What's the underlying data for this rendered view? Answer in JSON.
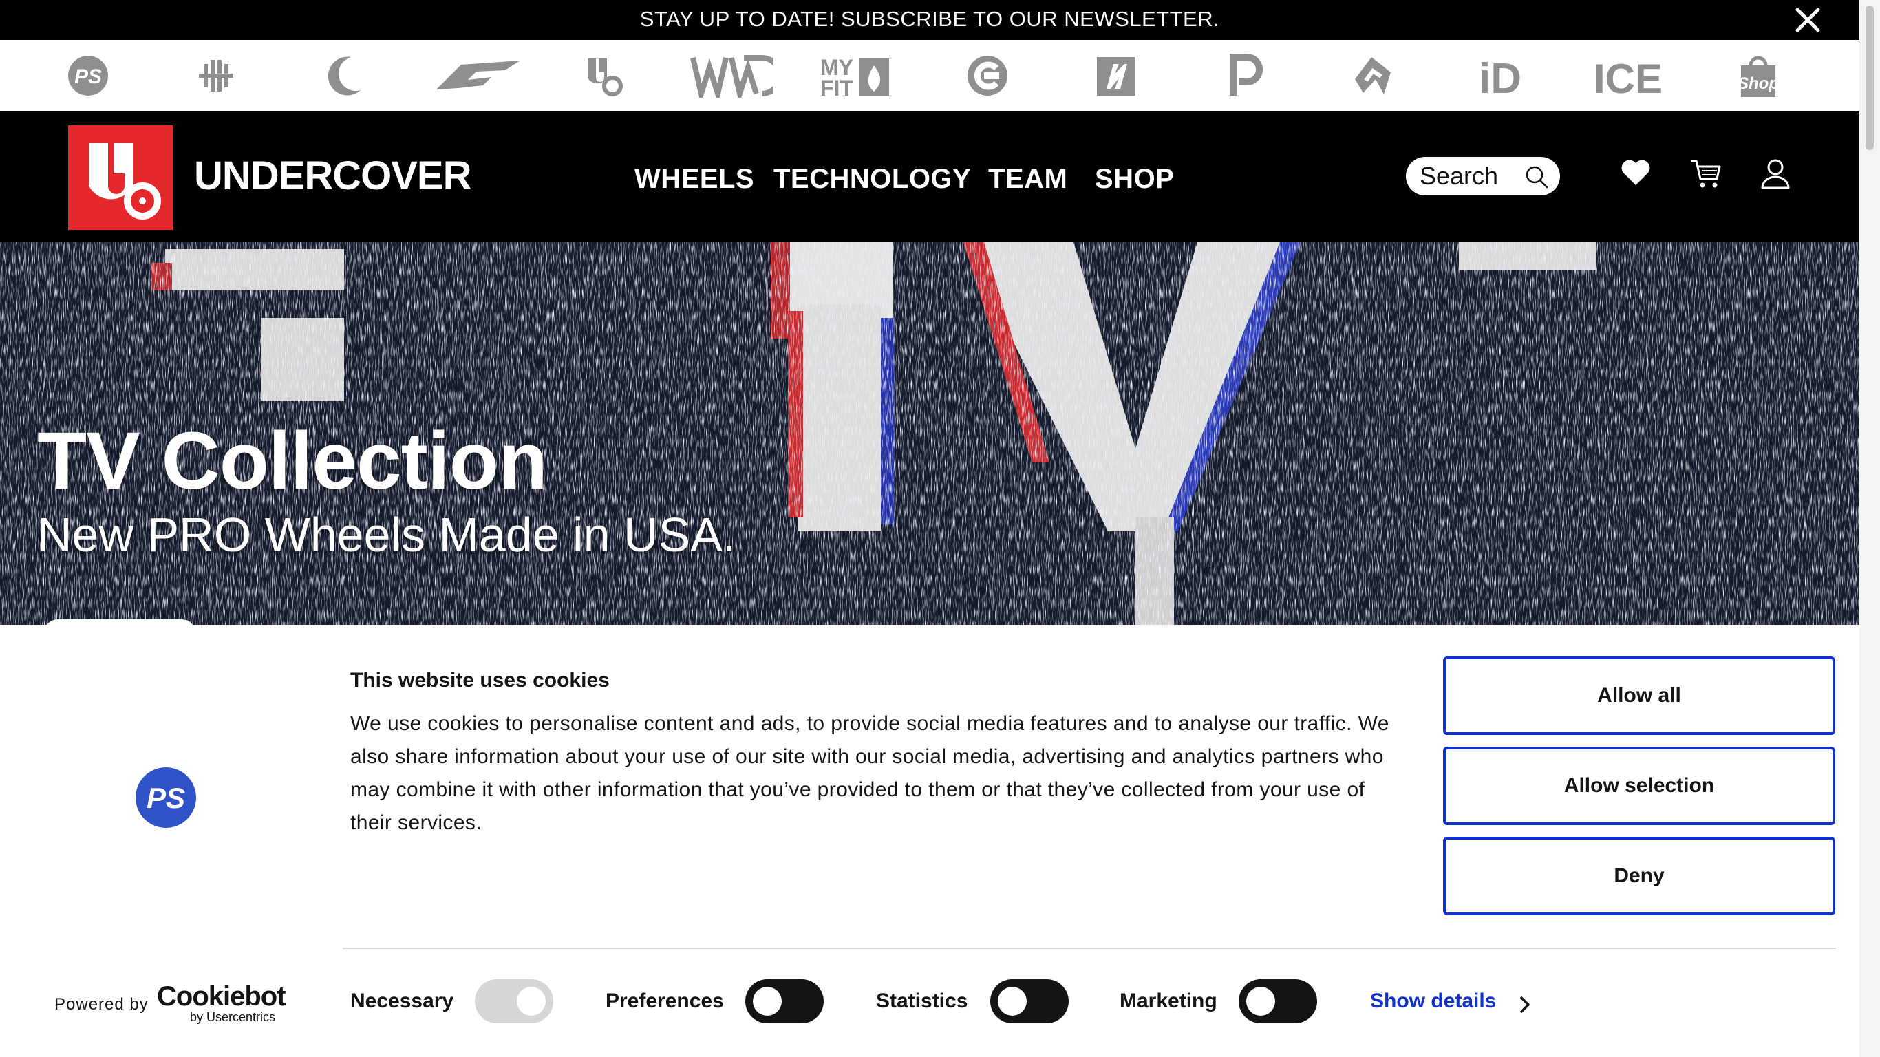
{
  "newsletter": {
    "text": "STAY UP TO DATE! SUBSCRIBE TO OUR NEWSLETTER."
  },
  "brands": [
    {
      "name": "ps-brand-icon",
      "text": "PS"
    },
    {
      "name": "seba-brand-icon",
      "text": ""
    },
    {
      "name": "crescent-brand-icon",
      "text": ""
    },
    {
      "name": "wing-brand-icon",
      "text": ""
    },
    {
      "name": "undercover-brand-icon",
      "text": ""
    },
    {
      "name": "wd-brand-icon",
      "text": ""
    },
    {
      "name": "myfit-brand-icon",
      "text": "MY FIT"
    },
    {
      "name": "c-brand-icon",
      "text": ""
    },
    {
      "name": "square-brand-icon",
      "text": ""
    },
    {
      "name": "p-brand-icon",
      "text": ""
    },
    {
      "name": "ramp-brand-icon",
      "text": ""
    },
    {
      "name": "id-brand-icon",
      "text": "iD"
    },
    {
      "name": "ice-brand-icon",
      "text": "ICE"
    },
    {
      "name": "shop-brand-icon",
      "text": "Shop"
    }
  ],
  "header": {
    "brand_name": "UNDERCOVER",
    "nav": [
      "WHEELS",
      "TECHNOLOGY",
      "TEAM",
      "SHOP"
    ],
    "search_placeholder": "Search"
  },
  "hero": {
    "title": "TV Collection",
    "subtitle": "New PRO Wheels Made in USA."
  },
  "cookie": {
    "title": "This website uses cookies",
    "text": "We use cookies to personalise content and ads, to provide social media features and to analyse our traffic. We also share information about your use of our site with our social media, advertising and analytics partners who may combine it with other information that you’ve provided to them or that they’ve collected from your use of their services.",
    "buttons": {
      "allow_all": "Allow all",
      "allow_selection": "Allow selection",
      "deny": "Deny"
    },
    "consent": [
      {
        "label": "Necessary",
        "state": "on",
        "disabled": true
      },
      {
        "label": "Preferences",
        "state": "off",
        "disabled": false
      },
      {
        "label": "Statistics",
        "state": "off",
        "disabled": false
      },
      {
        "label": "Marketing",
        "state": "off",
        "disabled": false
      }
    ],
    "show_details": "Show details",
    "powered_by": "Powered by",
    "cookiebot": "Cookiebot",
    "usercentrics": "by Usercentrics"
  },
  "colors": {
    "accent_blue": "#1032cf",
    "brand_red": "#e4282c",
    "header_bg": "#000000",
    "brand_icon_grey": "#8f8f8f"
  }
}
